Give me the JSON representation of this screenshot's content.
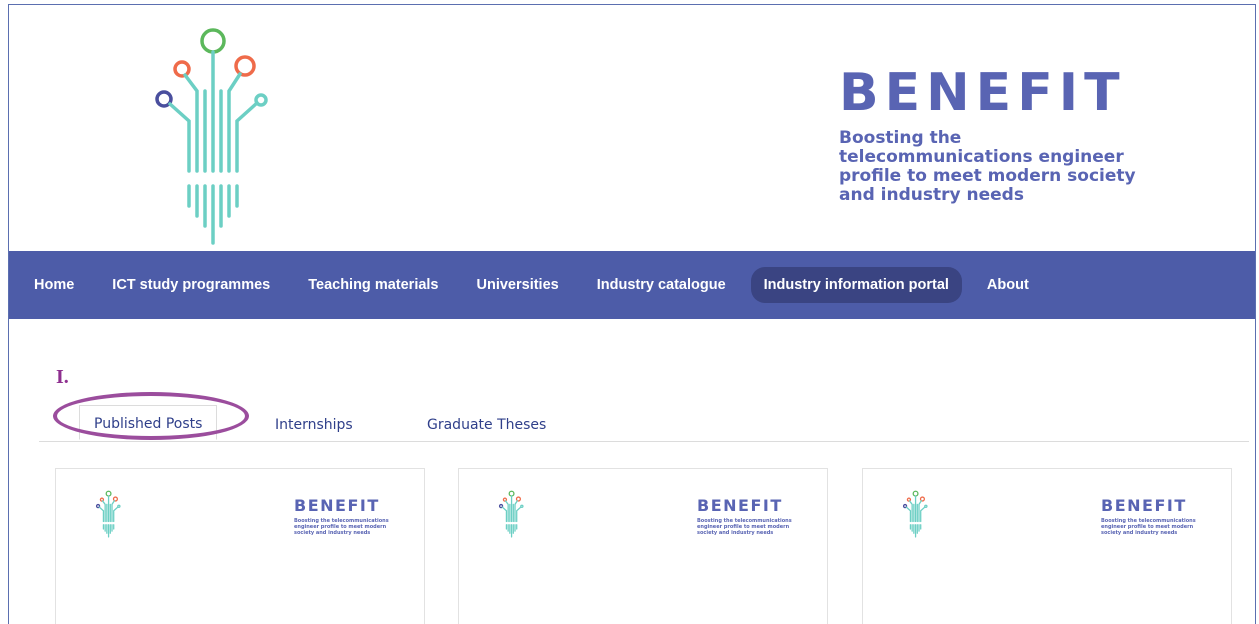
{
  "brand": {
    "title": "BENEFIT",
    "subtitle": "Boosting the telecommunications engineer profile to meet modern society and industry needs"
  },
  "nav": {
    "items": [
      {
        "label": "Home"
      },
      {
        "label": "ICT study programmes"
      },
      {
        "label": "Teaching materials"
      },
      {
        "label": "Universities"
      },
      {
        "label": "Industry catalogue"
      },
      {
        "label": "Industry information portal"
      },
      {
        "label": "About"
      }
    ],
    "active_index": 5
  },
  "annotation": {
    "marker": "I."
  },
  "tabs": [
    {
      "label": "Published Posts"
    },
    {
      "label": "Internships"
    },
    {
      "label": "Graduate Theses"
    }
  ],
  "cards": [
    {
      "brand_title": "BENEFIT",
      "brand_subtitle": "Boosting the telecommunications engineer profile to meet modern society and industry needs"
    },
    {
      "brand_title": "BENEFIT",
      "brand_subtitle": "Boosting the telecommunications engineer profile to meet modern society and industry needs"
    },
    {
      "brand_title": "BENEFIT",
      "brand_subtitle": "Boosting the telecommunications engineer profile to meet modern society and industry needs"
    }
  ],
  "colors": {
    "brand": "#5964b3",
    "nav_bg": "#4d5ca8",
    "nav_active": "#3a4482",
    "annotation": "#9b4d9d",
    "tree_teal": "#6ccfc4",
    "circle_green": "#5cb85c",
    "circle_orange": "#ef6b4a",
    "circle_navy": "#4a4f9e",
    "circle_teal": "#6ccfc4"
  }
}
